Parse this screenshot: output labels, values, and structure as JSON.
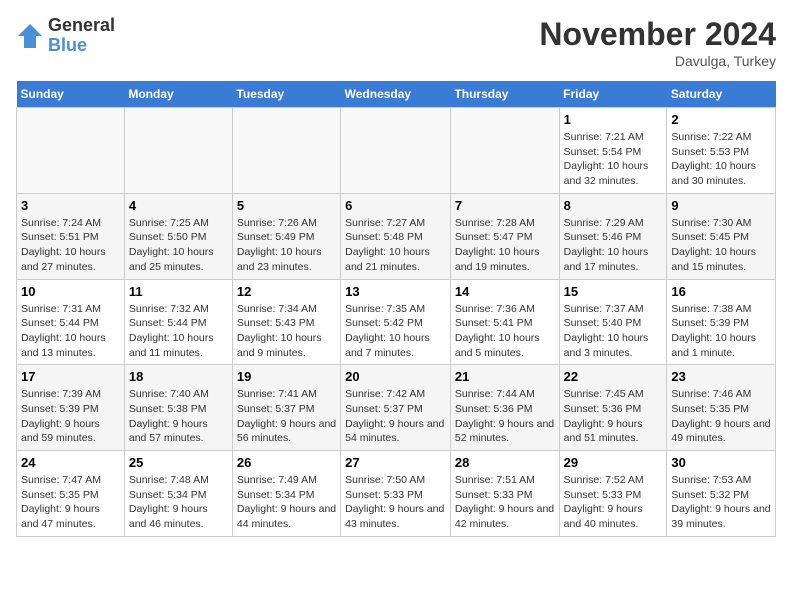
{
  "logo": {
    "general": "General",
    "blue": "Blue"
  },
  "header": {
    "month": "November 2024",
    "location": "Davulga, Turkey"
  },
  "weekdays": [
    "Sunday",
    "Monday",
    "Tuesday",
    "Wednesday",
    "Thursday",
    "Friday",
    "Saturday"
  ],
  "weeks": [
    [
      {
        "day": "",
        "info": ""
      },
      {
        "day": "",
        "info": ""
      },
      {
        "day": "",
        "info": ""
      },
      {
        "day": "",
        "info": ""
      },
      {
        "day": "",
        "info": ""
      },
      {
        "day": "1",
        "info": "Sunrise: 7:21 AM\nSunset: 5:54 PM\nDaylight: 10 hours and 32 minutes."
      },
      {
        "day": "2",
        "info": "Sunrise: 7:22 AM\nSunset: 5:53 PM\nDaylight: 10 hours and 30 minutes."
      }
    ],
    [
      {
        "day": "3",
        "info": "Sunrise: 7:24 AM\nSunset: 5:51 PM\nDaylight: 10 hours and 27 minutes."
      },
      {
        "day": "4",
        "info": "Sunrise: 7:25 AM\nSunset: 5:50 PM\nDaylight: 10 hours and 25 minutes."
      },
      {
        "day": "5",
        "info": "Sunrise: 7:26 AM\nSunset: 5:49 PM\nDaylight: 10 hours and 23 minutes."
      },
      {
        "day": "6",
        "info": "Sunrise: 7:27 AM\nSunset: 5:48 PM\nDaylight: 10 hours and 21 minutes."
      },
      {
        "day": "7",
        "info": "Sunrise: 7:28 AM\nSunset: 5:47 PM\nDaylight: 10 hours and 19 minutes."
      },
      {
        "day": "8",
        "info": "Sunrise: 7:29 AM\nSunset: 5:46 PM\nDaylight: 10 hours and 17 minutes."
      },
      {
        "day": "9",
        "info": "Sunrise: 7:30 AM\nSunset: 5:45 PM\nDaylight: 10 hours and 15 minutes."
      }
    ],
    [
      {
        "day": "10",
        "info": "Sunrise: 7:31 AM\nSunset: 5:44 PM\nDaylight: 10 hours and 13 minutes."
      },
      {
        "day": "11",
        "info": "Sunrise: 7:32 AM\nSunset: 5:44 PM\nDaylight: 10 hours and 11 minutes."
      },
      {
        "day": "12",
        "info": "Sunrise: 7:34 AM\nSunset: 5:43 PM\nDaylight: 10 hours and 9 minutes."
      },
      {
        "day": "13",
        "info": "Sunrise: 7:35 AM\nSunset: 5:42 PM\nDaylight: 10 hours and 7 minutes."
      },
      {
        "day": "14",
        "info": "Sunrise: 7:36 AM\nSunset: 5:41 PM\nDaylight: 10 hours and 5 minutes."
      },
      {
        "day": "15",
        "info": "Sunrise: 7:37 AM\nSunset: 5:40 PM\nDaylight: 10 hours and 3 minutes."
      },
      {
        "day": "16",
        "info": "Sunrise: 7:38 AM\nSunset: 5:39 PM\nDaylight: 10 hours and 1 minute."
      }
    ],
    [
      {
        "day": "17",
        "info": "Sunrise: 7:39 AM\nSunset: 5:39 PM\nDaylight: 9 hours and 59 minutes."
      },
      {
        "day": "18",
        "info": "Sunrise: 7:40 AM\nSunset: 5:38 PM\nDaylight: 9 hours and 57 minutes."
      },
      {
        "day": "19",
        "info": "Sunrise: 7:41 AM\nSunset: 5:37 PM\nDaylight: 9 hours and 56 minutes."
      },
      {
        "day": "20",
        "info": "Sunrise: 7:42 AM\nSunset: 5:37 PM\nDaylight: 9 hours and 54 minutes."
      },
      {
        "day": "21",
        "info": "Sunrise: 7:44 AM\nSunset: 5:36 PM\nDaylight: 9 hours and 52 minutes."
      },
      {
        "day": "22",
        "info": "Sunrise: 7:45 AM\nSunset: 5:36 PM\nDaylight: 9 hours and 51 minutes."
      },
      {
        "day": "23",
        "info": "Sunrise: 7:46 AM\nSunset: 5:35 PM\nDaylight: 9 hours and 49 minutes."
      }
    ],
    [
      {
        "day": "24",
        "info": "Sunrise: 7:47 AM\nSunset: 5:35 PM\nDaylight: 9 hours and 47 minutes."
      },
      {
        "day": "25",
        "info": "Sunrise: 7:48 AM\nSunset: 5:34 PM\nDaylight: 9 hours and 46 minutes."
      },
      {
        "day": "26",
        "info": "Sunrise: 7:49 AM\nSunset: 5:34 PM\nDaylight: 9 hours and 44 minutes."
      },
      {
        "day": "27",
        "info": "Sunrise: 7:50 AM\nSunset: 5:33 PM\nDaylight: 9 hours and 43 minutes."
      },
      {
        "day": "28",
        "info": "Sunrise: 7:51 AM\nSunset: 5:33 PM\nDaylight: 9 hours and 42 minutes."
      },
      {
        "day": "29",
        "info": "Sunrise: 7:52 AM\nSunset: 5:33 PM\nDaylight: 9 hours and 40 minutes."
      },
      {
        "day": "30",
        "info": "Sunrise: 7:53 AM\nSunset: 5:32 PM\nDaylight: 9 hours and 39 minutes."
      }
    ]
  ]
}
